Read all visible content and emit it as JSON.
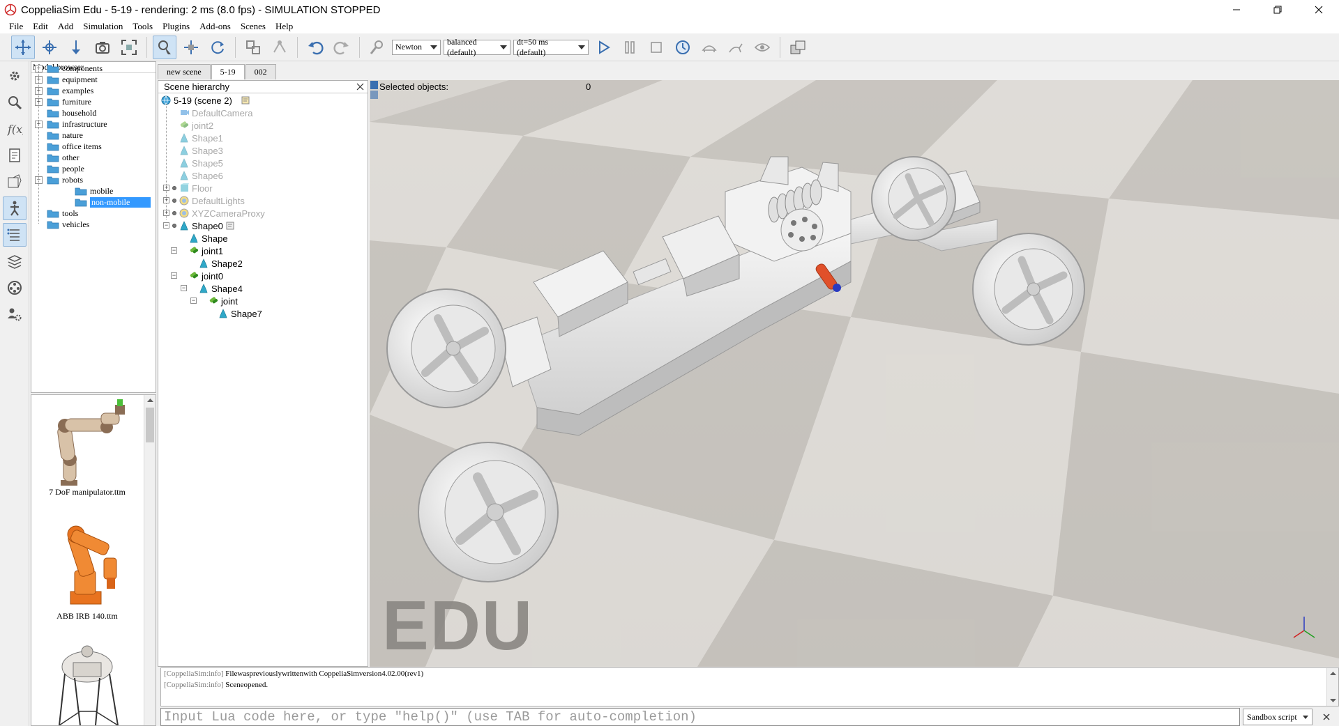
{
  "window": {
    "title": "CoppeliaSim Edu - 5-19 - rendering: 2 ms (8.0 fps) - SIMULATION STOPPED"
  },
  "menu": [
    "File",
    "Edit",
    "Add",
    "Simulation",
    "Tools",
    "Plugins",
    "Add-ons",
    "Scenes",
    "Help"
  ],
  "toolbar": {
    "engine": "Newton",
    "accuracy": "balanced (default)",
    "timestep": "dt=50 ms (default)"
  },
  "model_browser": {
    "title": "Model browser",
    "folders": [
      {
        "label": "components",
        "expandable": true
      },
      {
        "label": "equipment",
        "expandable": true
      },
      {
        "label": "examples",
        "expandable": true
      },
      {
        "label": "furniture",
        "expandable": true
      },
      {
        "label": "household",
        "expandable": false
      },
      {
        "label": "infrastructure",
        "expandable": true
      },
      {
        "label": "nature",
        "expandable": false
      },
      {
        "label": "office items",
        "expandable": false
      },
      {
        "label": "other",
        "expandable": false
      },
      {
        "label": "people",
        "expandable": false
      },
      {
        "label": "robots",
        "expandable": true,
        "expanded": true
      },
      {
        "label": "mobile",
        "child": true
      },
      {
        "label": "non-mobile",
        "child": true,
        "selected": true
      },
      {
        "label": "tools",
        "expandable": false
      },
      {
        "label": "vehicles",
        "expandable": false
      }
    ],
    "thumbnails": [
      "7 DoF manipulator.ttm",
      "ABB IRB 140.ttm"
    ]
  },
  "scene_tabs": [
    "new scene",
    "5-19",
    "002"
  ],
  "active_tab": "5-19",
  "hierarchy": {
    "title": "Scene hierarchy",
    "root": "5-19 (scene 2)",
    "items": [
      {
        "name": "DefaultCamera",
        "icon": "camera",
        "dim": true
      },
      {
        "name": "joint2",
        "icon": "joint",
        "dim": true
      },
      {
        "name": "Shape1",
        "icon": "shape",
        "dim": true
      },
      {
        "name": "Shape3",
        "icon": "shape",
        "dim": true
      },
      {
        "name": "Shape5",
        "icon": "shape",
        "dim": true
      },
      {
        "name": "Shape6",
        "icon": "shape",
        "dim": true
      },
      {
        "name": "Floor",
        "icon": "floor",
        "dim": true
      },
      {
        "name": "DefaultLights",
        "icon": "lights",
        "dim": true
      },
      {
        "name": "XYZCameraProxy",
        "icon": "lights",
        "dim": true
      },
      {
        "name": "Shape0",
        "icon": "shape",
        "dim": false
      },
      {
        "name": "Shape",
        "icon": "shape",
        "dim": false
      },
      {
        "name": "joint1",
        "icon": "joint",
        "dim": false
      },
      {
        "name": "Shape2",
        "icon": "shape",
        "dim": false
      },
      {
        "name": "joint0",
        "icon": "joint",
        "dim": false
      },
      {
        "name": "Shape4",
        "icon": "shape",
        "dim": false
      },
      {
        "name": "joint",
        "icon": "joint",
        "dim": false
      },
      {
        "name": "Shape7",
        "icon": "shape",
        "dim": false
      }
    ]
  },
  "viewport": {
    "selected_label": "Selected objects:",
    "selected_count": "0",
    "watermark": "EDU"
  },
  "console": {
    "lines": [
      {
        "tag": "[CoppeliaSim:info]",
        "text": "Filewaspreviouslywrittenwith CoppeliaSimversion4.02.00(rev1)"
      },
      {
        "tag": "[CoppeliaSim:info]",
        "text": "Sceneopened."
      }
    ]
  },
  "command": {
    "placeholder": "Input Lua code here, or type \"help()\" (use TAB for auto-completion)",
    "script": "Sandbox script"
  },
  "colors": {
    "selection": "#3399ff",
    "folder": "#4a9fd8",
    "shape": "#2fa8c8",
    "joint": "#6cb83a",
    "actuator": "#e0502a"
  }
}
